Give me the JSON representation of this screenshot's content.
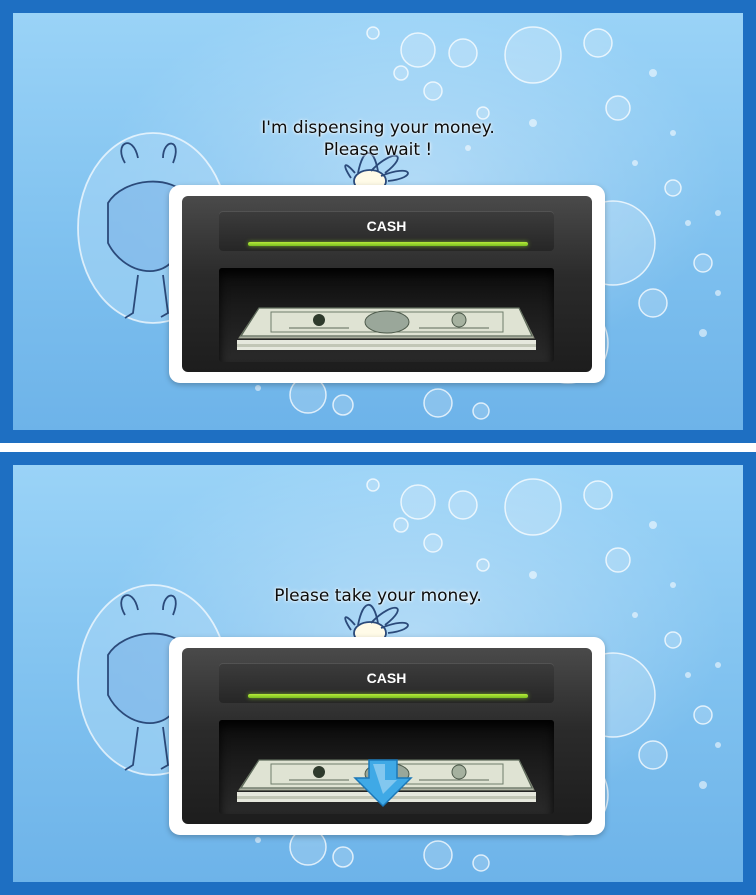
{
  "screens": [
    {
      "id": "dispensing",
      "message_line1": "I'm dispensing your money.",
      "message_line2": "Please wait !",
      "dispenser_label": "CASH",
      "progress_fraction": 1.0,
      "take_arrow_shown": false
    },
    {
      "id": "take-money",
      "message_line1": "Please take your money.",
      "dispenser_label": "CASH",
      "progress_fraction": 1.0,
      "take_arrow_shown": true
    }
  ],
  "colors": {
    "screen_border": "#1e6fc2",
    "background_light": "#9ad3f7",
    "progress_green": "#9cd52b",
    "arrow_blue": "#3fa9e6"
  },
  "icons": [
    "banknote-stack-icon",
    "down-arrow-icon",
    "bubbles-decoration",
    "cartoon-creature-illustration"
  ]
}
